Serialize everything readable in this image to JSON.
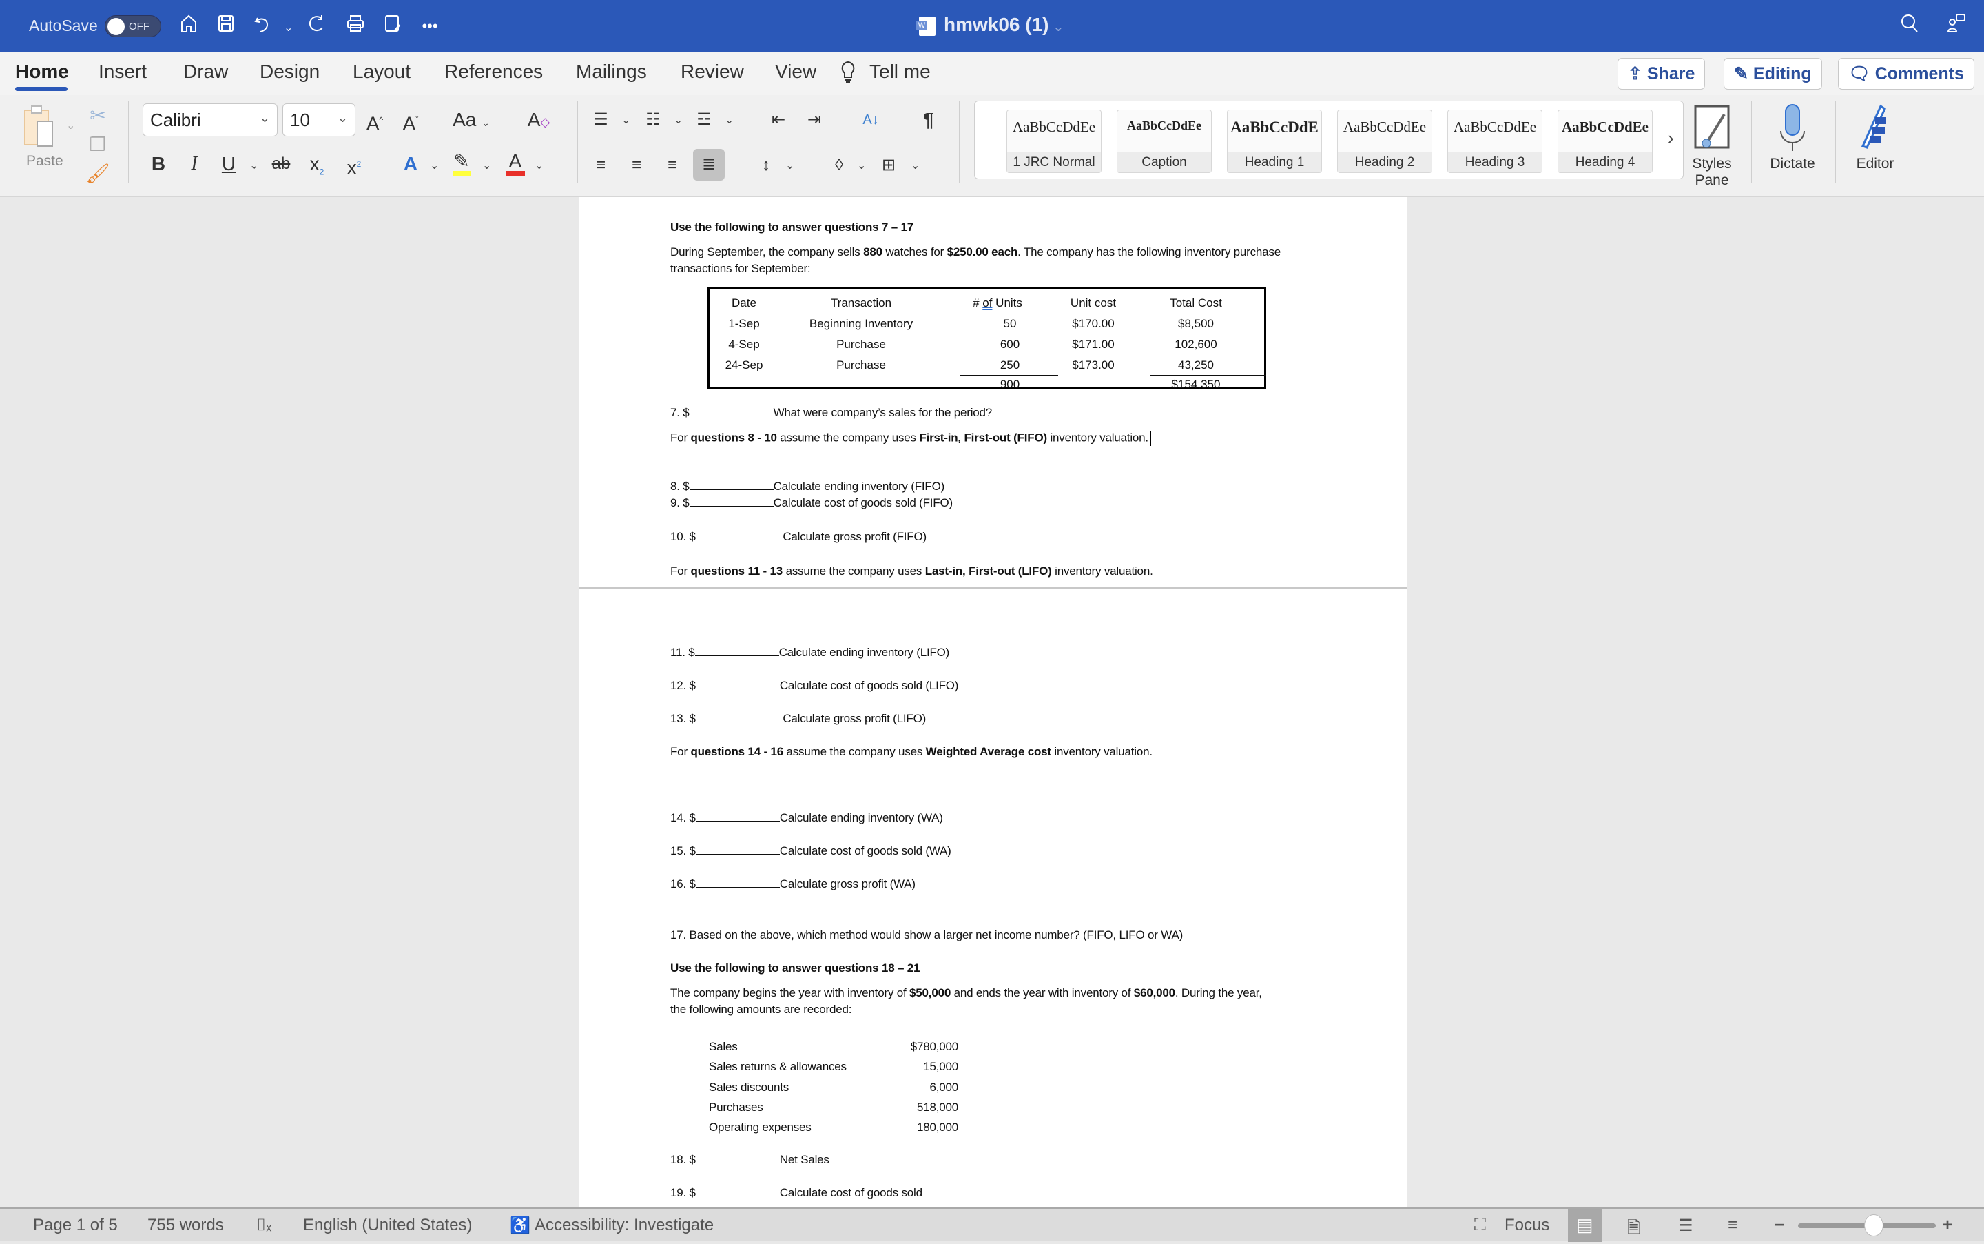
{
  "titlebar": {
    "autosave_label": "AutoSave",
    "autosave_state": "OFF",
    "doc_title": "hmwk06 (1)",
    "icons": [
      "home-icon",
      "save-icon",
      "undo-icon",
      "redo-icon",
      "print-icon",
      "save-as-icon",
      "more-icon",
      "search-icon",
      "share-people-icon"
    ]
  },
  "ribbon_tabs": {
    "tabs": [
      "Home",
      "Insert",
      "Draw",
      "Design",
      "Layout",
      "References",
      "Mailings",
      "Review",
      "View"
    ],
    "active": "Home",
    "tell_me": "Tell me",
    "share": "Share",
    "editing": "Editing",
    "comments": "Comments"
  },
  "ribbon": {
    "paste_label": "Paste",
    "font_name": "Calibri",
    "font_size": "10",
    "change_case": "Aa",
    "styles": [
      {
        "sample": "AaBbCcDdEe",
        "name": "1 JRC Normal"
      },
      {
        "sample": "AaBbCcDdEe",
        "name": "Caption"
      },
      {
        "sample": "AaBbCcDdE",
        "name": "Heading 1"
      },
      {
        "sample": "AaBbCcDdEe",
        "name": "Heading 2"
      },
      {
        "sample": "AaBbCcDdEe",
        "name": "Heading 3"
      },
      {
        "sample": "AaBbCcDdEe",
        "name": "Heading 4"
      }
    ],
    "styles_pane": "Styles Pane",
    "dictate": "Dictate",
    "editor": "Editor",
    "colors": {
      "highlight": "#ffff3c",
      "font_color": "#e8302a"
    }
  },
  "document": {
    "heading1": "Use the following to answer questions 7 – 17",
    "intro_pre": "During September, the company sells ",
    "intro_qty": "880",
    "intro_mid": " watches for ",
    "intro_price": "$250.00 each",
    "intro_post": ".  The company has the following inventory purchase",
    "intro_line2": "transactions for September:",
    "table": {
      "headers": [
        "Date",
        "Transaction",
        "# of Units",
        "Unit cost",
        "Total Cost"
      ],
      "rows": [
        [
          "1-Sep",
          "Beginning Inventory",
          "50",
          "$170.00",
          "$8,500"
        ],
        [
          "4-Sep",
          "Purchase",
          "600",
          "$171.00",
          "102,600"
        ],
        [
          "24-Sep",
          "Purchase",
          "250",
          "$173.00",
          "43,250"
        ]
      ],
      "total_units": "900",
      "total_cost": "$154,350"
    },
    "q7": {
      "num": "7.  $",
      "text": "What were company’s sales for the period?"
    },
    "fifo_intro": {
      "pre": "For ",
      "bold1": "questions 8 - 10",
      "mid": " assume the company uses ",
      "bold2": "First-in, First-out (FIFO)",
      "post": " inventory valuation."
    },
    "q8": {
      "num": "8.  $",
      "text": "Calculate ending inventory (FIFO)"
    },
    "q9": {
      "num": "9.  $",
      "text": "Calculate cost of goods sold (FIFO)"
    },
    "q10": {
      "num": "10. $",
      "text": " Calculate gross profit (FIFO)"
    },
    "lifo_intro": {
      "pre": "For ",
      "bold1": "questions 11 - 13",
      "mid": " assume the company uses ",
      "bold2": "Last-in, First-out (LIFO)",
      "post": " inventory valuation."
    },
    "q11": {
      "num": "11.  $",
      "text": "Calculate ending inventory (LIFO)"
    },
    "q12": {
      "num": "12.  $",
      "text": "Calculate cost of goods sold (LIFO)"
    },
    "q13": {
      "num": "13. $",
      "text": " Calculate gross profit (LIFO)"
    },
    "wa_intro": {
      "pre": "For ",
      "bold1": "questions 14 - 16",
      "mid": " assume the company uses ",
      "bold2": "Weighted Average cost",
      "post": " inventory valuation."
    },
    "q14": {
      "num": "14.  $",
      "text": "Calculate ending inventory (WA)"
    },
    "q15": {
      "num": "15.  $",
      "text": "Calculate cost of goods sold (WA)"
    },
    "q16": {
      "num": "16.  $",
      "text": "Calculate gross profit (WA)"
    },
    "q17": "17.  Based on the above, which method would show a larger net income number? (FIFO, LIFO or WA)",
    "heading2": "Use the following to answer questions 18 – 21",
    "para2_pre": "The company begins the year with inventory of ",
    "para2_b1": "$50,000",
    "para2_mid": " and ends the year with inventory of ",
    "para2_b2": "$60,000",
    "para2_post": ".  During the year,",
    "para2_line2": "the following amounts are recorded:",
    "amounts": [
      {
        "label": "Sales",
        "value": "$780,000"
      },
      {
        "label": "Sales returns & allowances",
        "value": "15,000"
      },
      {
        "label": "Sales discounts",
        "value": "6,000"
      },
      {
        "label": "Purchases",
        "value": "518,000"
      },
      {
        "label": "Operating expenses",
        "value": "180,000"
      }
    ],
    "q18": {
      "num": "18.  $",
      "text": "Net Sales"
    },
    "q19": {
      "num": "19.  $",
      "text": "Calculate cost of goods sold"
    }
  },
  "statusbar": {
    "page": "Page 1 of 5",
    "words": "755 words",
    "language": "English (United States)",
    "accessibility": "Accessibility: Investigate",
    "focus": "Focus",
    "zoom_level_fraction": 0.55
  }
}
